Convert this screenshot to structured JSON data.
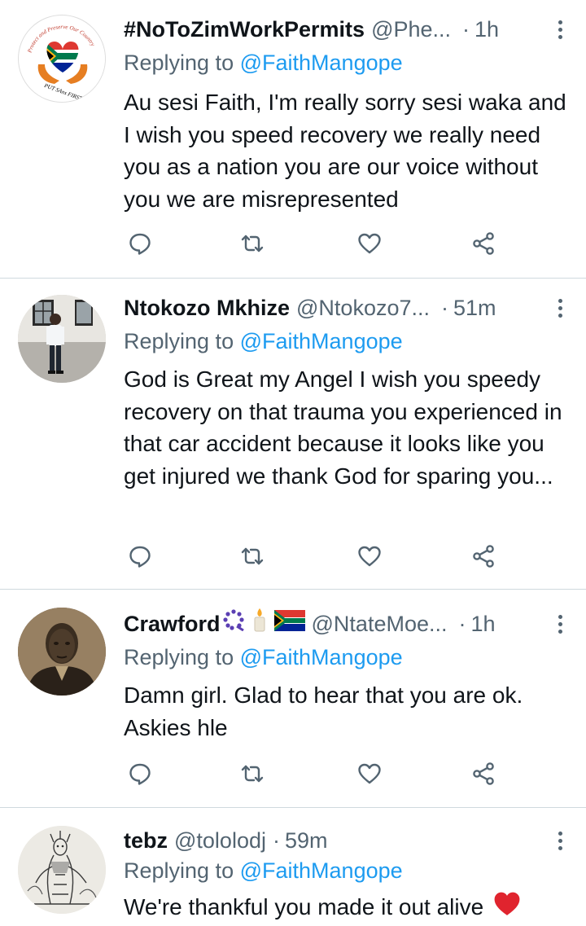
{
  "colors": {
    "text": "#0f1419",
    "secondary": "#536471",
    "link": "#1d9bf0",
    "divider": "#cfd9de"
  },
  "replies": [
    {
      "name": "#NoToZimWorkPermits",
      "handle": "@Phe...",
      "dot": "·",
      "time": "1h",
      "replying_prefix": "Replying to",
      "mention": "@FaithMangope",
      "text": "Au sesi Faith, I'm really sorry sesi waka and I wish you speed recovery we really need you as a nation you are our voice without you we are misrepresented",
      "avatar": "south-africa-heart-hands-logo",
      "avatar_text": [
        "Protect and Preserve Our Country",
        "PUT SAns FIRST"
      ]
    },
    {
      "name": "Ntokozo Mkhize",
      "handle": "@Ntokozo7...",
      "dot": "·",
      "time": "51m",
      "replying_prefix": "Replying to",
      "mention": "@FaithMangope",
      "text": "God is Great my Angel I wish you speedy recovery on that trauma you experienced in that car accident because it looks like you get injured we thank God for sparing you...",
      "avatar": "person-standing-photo"
    },
    {
      "name": "Crawford",
      "name_emojis": [
        "prayer-beads-emoji",
        "candle-emoji",
        "south-africa-flag-emoji"
      ],
      "handle": "@NtateMoe...",
      "dot": "·",
      "time": "1h",
      "replying_prefix": "Replying to",
      "mention": "@FaithMangope",
      "text": "Damn girl. Glad to hear that you are ok. Askies hle",
      "avatar": "sepia-portrait-photo"
    },
    {
      "name": "tebz",
      "handle": "@tololodj",
      "dot": "·",
      "time": "59m",
      "replying_prefix": "Replying to",
      "mention": "@FaithMangope",
      "text": "We're thankful you made it out alive",
      "text_emoji": "red-heart-emoji",
      "avatar": "sketch-drawing-photo"
    }
  ]
}
